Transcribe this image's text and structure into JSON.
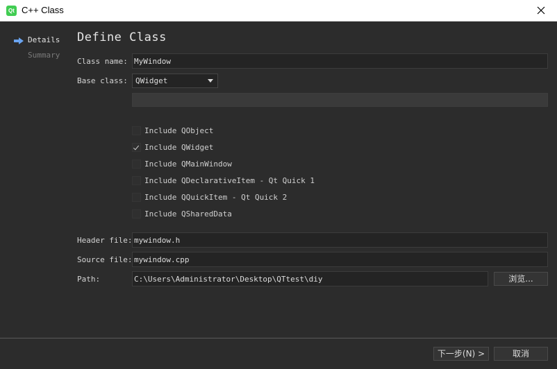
{
  "window": {
    "title": "C++ Class",
    "app_icon": "Qt"
  },
  "sidebar": {
    "items": [
      {
        "label": "Details",
        "active": true
      },
      {
        "label": "Summary",
        "active": false
      }
    ]
  },
  "page": {
    "title": "Define Class"
  },
  "form": {
    "class_name_label": "Class name:",
    "class_name_value": "MyWindow",
    "base_class_label": "Base class:",
    "base_class_value": "QWidget",
    "checkboxes": [
      {
        "label": "Include QObject",
        "checked": false
      },
      {
        "label": "Include QWidget",
        "checked": true
      },
      {
        "label": "Include QMainWindow",
        "checked": false
      },
      {
        "label": "Include QDeclarativeItem - Qt Quick 1",
        "checked": false
      },
      {
        "label": "Include QQuickItem - Qt Quick 2",
        "checked": false
      },
      {
        "label": "Include QSharedData",
        "checked": false
      }
    ],
    "header_file_label": "Header file:",
    "header_file_value": "mywindow.h",
    "source_file_label": "Source file:",
    "source_file_value": "mywindow.cpp",
    "path_label": "Path:",
    "path_value": "C:\\Users\\Administrator\\Desktop\\QTtest\\diy",
    "browse_label": "浏览..."
  },
  "footer": {
    "next_label": "下一步(N) >",
    "cancel_label": "取消"
  },
  "colors": {
    "background": "#2c2c2c",
    "accent_arrow": "#6aa4f0",
    "qt_green": "#41cd52"
  }
}
